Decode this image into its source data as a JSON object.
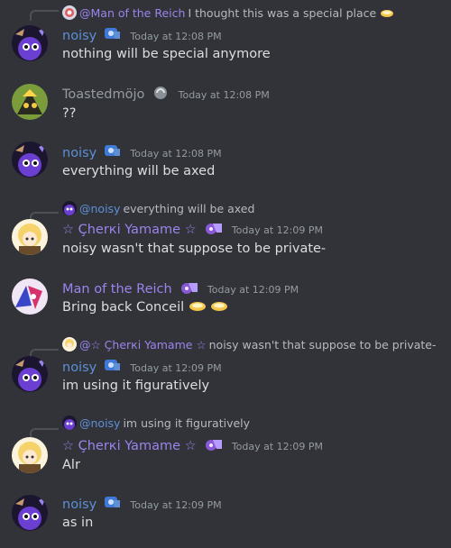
{
  "messages": [
    {
      "reply": {
        "author": "@Man of the Reich",
        "text": "I thought this was a special place",
        "emoji": "duck-emoji"
      },
      "author": "noisy",
      "timestamp": "Today at 12:08 PM",
      "text": "nothing will be special anymore"
    },
    {
      "author": "Toastedmöjo",
      "timestamp": "Today at 12:08 PM",
      "text": "??"
    },
    {
      "author": "noisy",
      "timestamp": "Today at 12:08 PM",
      "text": "everything will be axed"
    },
    {
      "reply": {
        "author": "@noisy",
        "text": "everything will be axed"
      },
      "author": "☆ Çherкi Yamame ☆",
      "timestamp": "Today at 12:09 PM",
      "text": "noisy wasn't that suppose to be private-"
    },
    {
      "author": "Man of the Reich",
      "timestamp": "Today at 12:09 PM",
      "text": "Bring back Conceil"
    },
    {
      "reply": {
        "author": "@☆ Çherкi Yamame ☆",
        "text": "noisy wasn't that suppose to be private-"
      },
      "author": "noisy",
      "timestamp": "Today at 12:09 PM",
      "text": "im using it figuratively"
    },
    {
      "reply": {
        "author": "@noisy",
        "text": "im using it figuratively"
      },
      "author": "☆ Çherкi Yamame ☆",
      "timestamp": "Today at 12:09 PM",
      "text": "Alr"
    },
    {
      "author": "noisy",
      "timestamp": "Today at 12:09 PM",
      "text": "as in"
    }
  ]
}
